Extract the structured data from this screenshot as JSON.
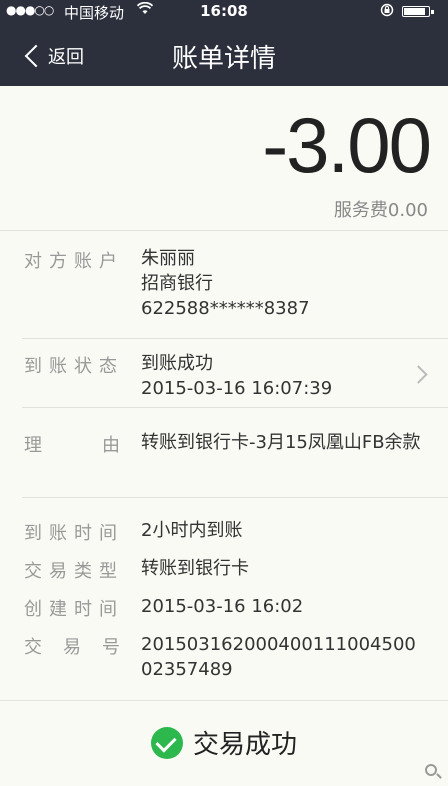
{
  "status_bar": {
    "signal": "●●●○○",
    "carrier": "中国移动",
    "time": "16:08"
  },
  "nav": {
    "back_label": "返回",
    "title": "账单详情"
  },
  "summary": {
    "amount": "-3.00",
    "fee": "服务费0.00"
  },
  "counterparty": {
    "label": "对方账户",
    "name": "朱丽丽",
    "bank": "招商银行",
    "card": "622588******8387"
  },
  "arrival_status": {
    "label": "到账状态",
    "status": "到账成功",
    "time": "2015-03-16 16:07:39"
  },
  "reason": {
    "label_chars": [
      "理",
      "由"
    ],
    "text": "转账到银行卡-3月15凤凰山FB余款"
  },
  "details": [
    {
      "label": "到账时间",
      "value": "2小时内到账"
    },
    {
      "label": "交易类型",
      "value": "转账到银行卡"
    },
    {
      "label": "创建时间",
      "value": "2015-03-16 16:02"
    }
  ],
  "transaction_no": {
    "label_chars": [
      "交",
      "易",
      "号"
    ],
    "value": "201503162000400111004500023574 89"
  },
  "result": {
    "text": "交易成功",
    "color": "#2db84d"
  },
  "colors": {
    "header_bg": "#2c2f3c",
    "page_bg": "#fafaf5"
  }
}
